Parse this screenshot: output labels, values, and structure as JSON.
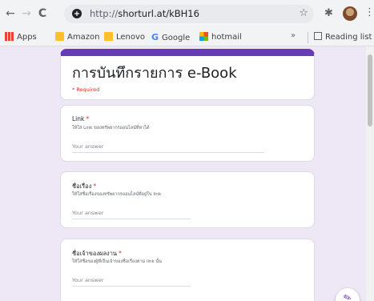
{
  "browser": {
    "url_prefix": "http://",
    "url_host": "shorturl.at/kBH16",
    "back": "←",
    "forward": "→",
    "reload": "C",
    "star": "☆",
    "extension": "✱",
    "menu": "⋮"
  },
  "bookmarks": {
    "apps": "Apps",
    "amazon": "Amazon",
    "lenovo": "Lenovo",
    "google": "Google",
    "hotmail": "hotmail",
    "overflow": "»",
    "reading_list": "Reading list"
  },
  "form": {
    "title": "การบันทึกรายการ e-Book",
    "required_note": "* Required",
    "questions": [
      {
        "label": "Link",
        "help": "ให้ใส่ Link ของทรัพยากรออนไลน์ที่หาได้",
        "placeholder": "Your answer"
      },
      {
        "label": "ชื่อเรื่อง",
        "help": "ให้ใส่ชื่อเรื่องของทรัพยากรออนไลน์ที่อยู่ใน link",
        "placeholder": "Your answer"
      },
      {
        "label": "ชื่อเจ้าของผลงาน",
        "help": "ให้ใส่ชื่อของผู้ที่เป็นเจ้าของชื่อเรื่องตาม link นั้น",
        "placeholder": "Your answer"
      }
    ],
    "required_mark": "*"
  },
  "colors": {
    "accent": "#673ab7",
    "background": "#ede7f6",
    "required": "#d93025"
  }
}
